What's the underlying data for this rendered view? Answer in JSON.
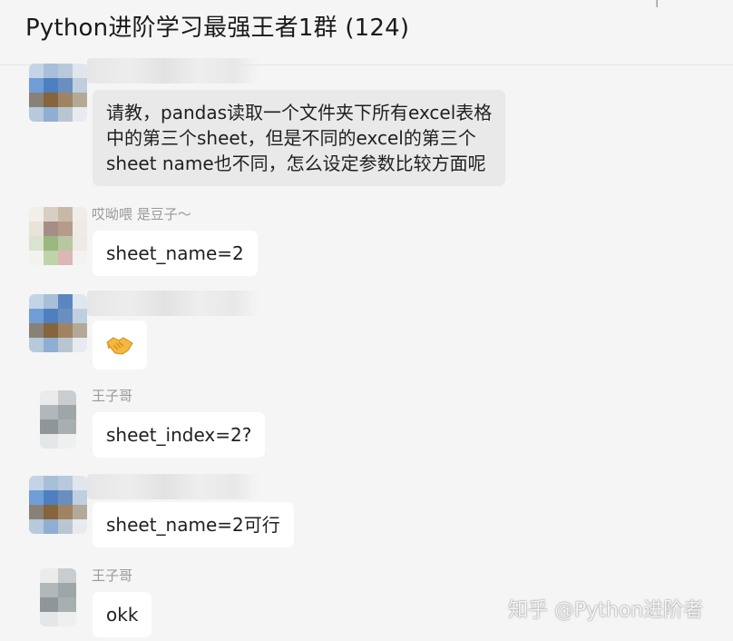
{
  "header": {
    "title": "Python进阶学习最强王者1群 (124)"
  },
  "messages": [
    {
      "sender": "",
      "text_lines": [
        "请教，pandas读取一个文件夹下所有excel表格",
        "中的第三个sheet，但是不同的excel的第三个",
        "sheet name也不同，怎么设定参数比较方面呢"
      ]
    },
    {
      "sender": "哎呦喂  是豆子～",
      "text": "sheet_name=2"
    },
    {
      "sender": "",
      "emoji": "handshake"
    },
    {
      "sender": "王子哥",
      "text": "sheet_index=2?"
    },
    {
      "sender": "",
      "text": "sheet_name=2可行"
    },
    {
      "sender": "王子哥",
      "text": "okk"
    }
  ],
  "watermark": "知乎 @Python进阶者"
}
